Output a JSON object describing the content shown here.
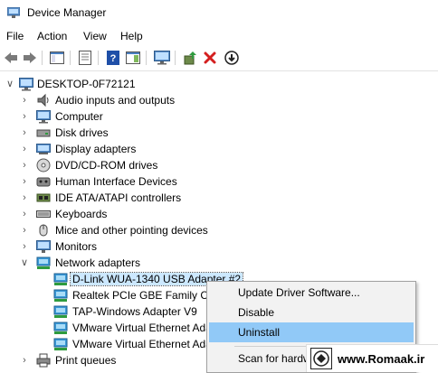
{
  "window": {
    "title": "Device Manager"
  },
  "menu": [
    "File",
    "Action",
    "View",
    "Help"
  ],
  "toolbar": {
    "icons": [
      "back-icon",
      "forward-icon",
      "properties-view-icon",
      "show-hide-icon",
      "help-icon",
      "console-tree-icon",
      "monitor-icon",
      "update-driver-icon",
      "uninstall-icon",
      "scan-hardware-icon"
    ]
  },
  "tree": {
    "root": "DESKTOP-0F72121",
    "categories": [
      {
        "label": "Audio inputs and outputs",
        "icon": "speaker-icon"
      },
      {
        "label": "Computer",
        "icon": "computer-icon"
      },
      {
        "label": "Disk drives",
        "icon": "disk-drive-icon"
      },
      {
        "label": "Display adapters",
        "icon": "display-adapter-icon"
      },
      {
        "label": "DVD/CD-ROM drives",
        "icon": "dvd-drive-icon"
      },
      {
        "label": "Human Interface Devices",
        "icon": "hid-icon"
      },
      {
        "label": "IDE ATA/ATAPI controllers",
        "icon": "ide-controller-icon"
      },
      {
        "label": "Keyboards",
        "icon": "keyboard-icon"
      },
      {
        "label": "Mice and other pointing devices",
        "icon": "mouse-icon"
      },
      {
        "label": "Monitors",
        "icon": "monitor-icon"
      },
      {
        "label": "Network adapters",
        "icon": "network-adapter-icon"
      }
    ],
    "network_children": [
      "D-Link WUA-1340 USB Adapter #2",
      "Realtek PCIe GBE Family Con",
      "TAP-Windows Adapter V9",
      "VMware Virtual Ethernet Ada",
      "VMware Virtual Ethernet Ada"
    ],
    "after": [
      {
        "label": "Print queues",
        "icon": "printer-icon"
      }
    ]
  },
  "context_menu": {
    "items": [
      "Update Driver Software...",
      "Disable",
      "Uninstall",
      "Scan for hardw"
    ],
    "highlighted": "Uninstall"
  },
  "watermark": {
    "text": "www.Romaak.ir"
  },
  "colors": {
    "selection": "#cce8ff",
    "menu_highlight": "#91c9f7",
    "menu_bg": "#f2f2f2"
  }
}
